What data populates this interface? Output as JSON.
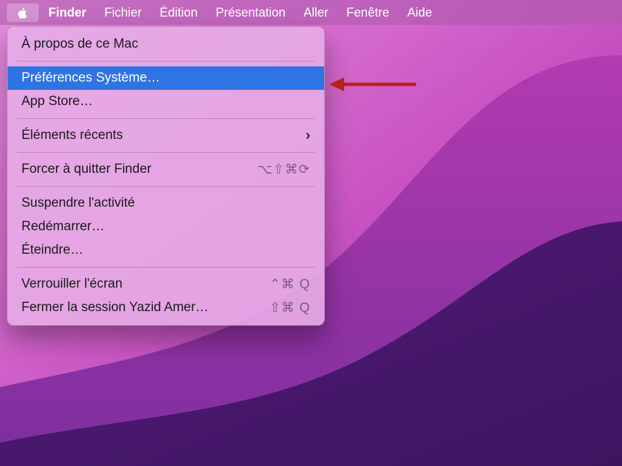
{
  "menubar": {
    "app": "Finder",
    "items": [
      "Fichier",
      "Édition",
      "Présentation",
      "Aller",
      "Fenêtre",
      "Aide"
    ]
  },
  "apple_menu": {
    "about": "À propos de ce Mac",
    "prefs": "Préférences Système…",
    "appstore": "App Store…",
    "recents": "Éléments récents",
    "force_quit": "Forcer à quitter Finder",
    "force_quit_shortcut": "⌥⇧⌘⟳",
    "sleep": "Suspendre l'activité",
    "restart": "Redémarrer…",
    "shutdown": "Éteindre…",
    "lock": "Verrouiller l'écran",
    "lock_shortcut": "⌃⌘ Q",
    "logout": "Fermer la session Yazid Amer…",
    "logout_shortcut": "⇧⌘ Q"
  }
}
